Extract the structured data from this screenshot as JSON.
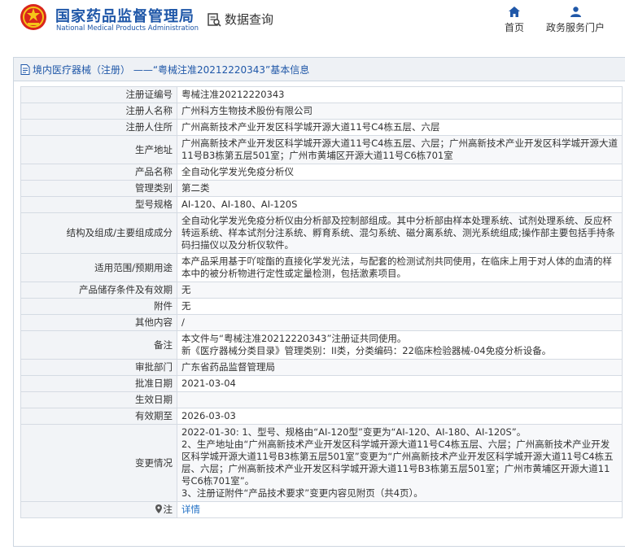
{
  "header": {
    "logo_cn": "国家药品监督管理局",
    "logo_en": "National Medical Products Administration",
    "search_label": "数据查询",
    "nav": [
      {
        "label": "首页",
        "icon": "home-icon"
      },
      {
        "label": "政务服务门户",
        "icon": "user-icon"
      }
    ]
  },
  "panel": {
    "title": "境内医疗器械（注册） ——“粤械注准20212220343”基本信息"
  },
  "rows": [
    {
      "label": "注册证编号",
      "value": "粤械注准20212220343"
    },
    {
      "label": "注册人名称",
      "value": "广州科方生物技术股份有限公司"
    },
    {
      "label": "注册人住所",
      "value": "广州高新技术产业开发区科学城开源大道11号C4栋五层、六层"
    },
    {
      "label": "生产地址",
      "value": "广州高新技术产业开发区科学城开源大道11号C4栋五层、六层；广州高新技术产业开发区科学城开源大道11号B3栋第五层501室；广州市黄埔区开源大道11号C6栋701室"
    },
    {
      "label": "产品名称",
      "value": "全自动化学发光免疫分析仪"
    },
    {
      "label": "管理类别",
      "value": "第二类"
    },
    {
      "label": "型号规格",
      "value": "AI-120、AI-180、AI-120S"
    },
    {
      "label": "结构及组成/主要组成成分",
      "value": "全自动化学发光免疫分析仪由分析部及控制部组成。其中分析部由样本处理系统、试剂处理系统、反应杯转运系统、样本试剂分注系统、孵育系统、混匀系统、磁分离系统、测光系统组成;操作部主要包括手持条码扫描仪以及分析仪软件。"
    },
    {
      "label": "适用范围/预期用途",
      "value": "本产品采用基于吖啶酯的直接化学发光法，与配套的检测试剂共同使用，在临床上用于对人体的血清的样本中的被分析物进行定性或定量检测，包括激素项目。"
    },
    {
      "label": "产品储存条件及有效期",
      "value": "无"
    },
    {
      "label": "附件",
      "value": "无"
    },
    {
      "label": "其他内容",
      "value": "/"
    },
    {
      "label": "备注",
      "value": "本文件与“粤械注准20212220343”注册证共同使用。\n新《医疗器械分类目录》管理类别：II类，分类编码：22临床检验器械-04免疫分析设备。"
    },
    {
      "label": "审批部门",
      "value": "广东省药品监督管理局"
    },
    {
      "label": "批准日期",
      "value": "2021-03-04"
    },
    {
      "label": "生效日期",
      "value": ""
    },
    {
      "label": "有效期至",
      "value": "2026-03-03"
    },
    {
      "label": "变更情况",
      "value": "2022-01-30: 1、型号、规格由“AI-120型”变更为“AI-120、AI-180、AI-120S”。\n2、生产地址由“广州高新技术产业开发区科学城开源大道11号C4栋五层、六层；广州高新技术产业开发区科学城开源大道11号B3栋第五层501室”变更为“广州高新技术产业开发区科学城开源大道11号C4栋五层、六层；广州高新技术产业开发区科学城开源大道11号B3栋第五层501室；广州市黄埔区开源大道11号C6栋701室”。\n3、注册证附件“产品技术要求”变更内容见附页（共4页）。"
    },
    {
      "label": "注",
      "value": "详情",
      "icon": "pin-icon"
    }
  ]
}
